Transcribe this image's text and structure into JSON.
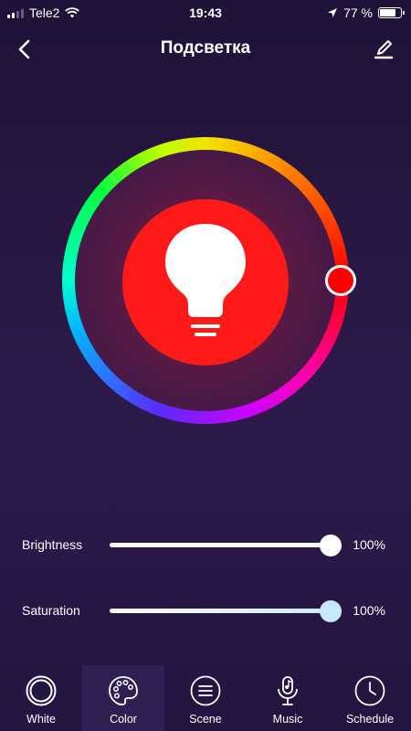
{
  "status_bar": {
    "carrier": "Tele2",
    "time": "19:43",
    "battery_percent": "77 %",
    "battery_level": 0.77,
    "signal_bars": 4,
    "signal_bars_active": 2,
    "icons": [
      "signal-icon",
      "wifi-icon",
      "location-arrow-icon",
      "battery-icon"
    ]
  },
  "header": {
    "title": "Подсветка",
    "back_icon": "chevron-left-icon",
    "edit_icon": "pencil-icon"
  },
  "color_wheel": {
    "selected_color": "#ff0000",
    "bulb_color": "#ff1a1a",
    "icon": "light-bulb-icon"
  },
  "sliders": {
    "brightness": {
      "label": "Brightness",
      "value": "100%",
      "level": 1.0
    },
    "saturation": {
      "label": "Saturation",
      "value": "100%",
      "level": 1.0
    }
  },
  "tabs": [
    {
      "label": "White",
      "icon": "circle-ring-icon",
      "active": false
    },
    {
      "label": "Color",
      "icon": "palette-icon",
      "active": true
    },
    {
      "label": "Scene",
      "icon": "list-circle-icon",
      "active": false
    },
    {
      "label": "Music",
      "icon": "microphone-note-icon",
      "active": false
    },
    {
      "label": "Schedule",
      "icon": "clock-icon",
      "active": false
    }
  ],
  "colors": {
    "background": "#2a1846",
    "active_tab": "#2f1f52",
    "accent_red": "#ff0000"
  }
}
